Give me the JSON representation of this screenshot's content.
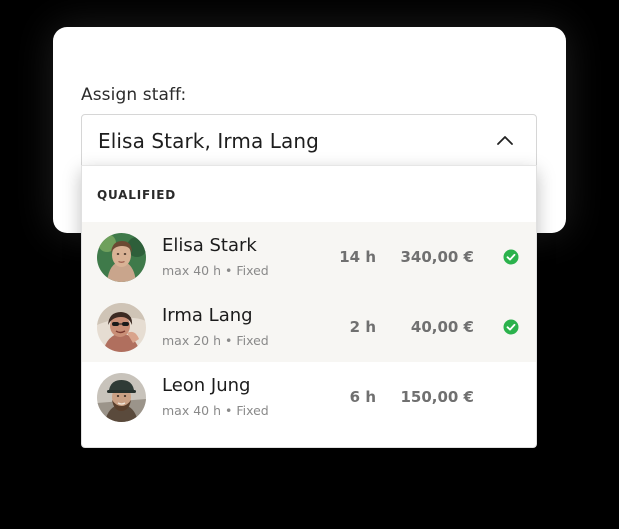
{
  "form": {
    "label": "Assign staff:",
    "selected_value": "Elisa Stark, Irma Lang"
  },
  "dropdown": {
    "section_header": "QUALIFIED",
    "items": [
      {
        "name": "Elisa Stark",
        "meta": "max 40 h • Fixed",
        "hours": "14 h",
        "amount": "340,00 €",
        "selected": true
      },
      {
        "name": "Irma Lang",
        "meta": "max 20 h • Fixed",
        "hours": "2 h",
        "amount": "40,00 €",
        "selected": true
      },
      {
        "name": "Leon Jung",
        "meta": "max 40 h • Fixed",
        "hours": "6 h",
        "amount": "150,00 €",
        "selected": false
      }
    ]
  },
  "icons": {
    "open_state": "chevron-up-icon",
    "selected_mark": "check-circle-icon"
  },
  "colors": {
    "selected_row_bg": "#f7f6f3",
    "check_green": "#2bb24c",
    "text_primary": "#1c1c1c",
    "text_muted": "#8a8a8a",
    "value_gray": "#707070"
  }
}
